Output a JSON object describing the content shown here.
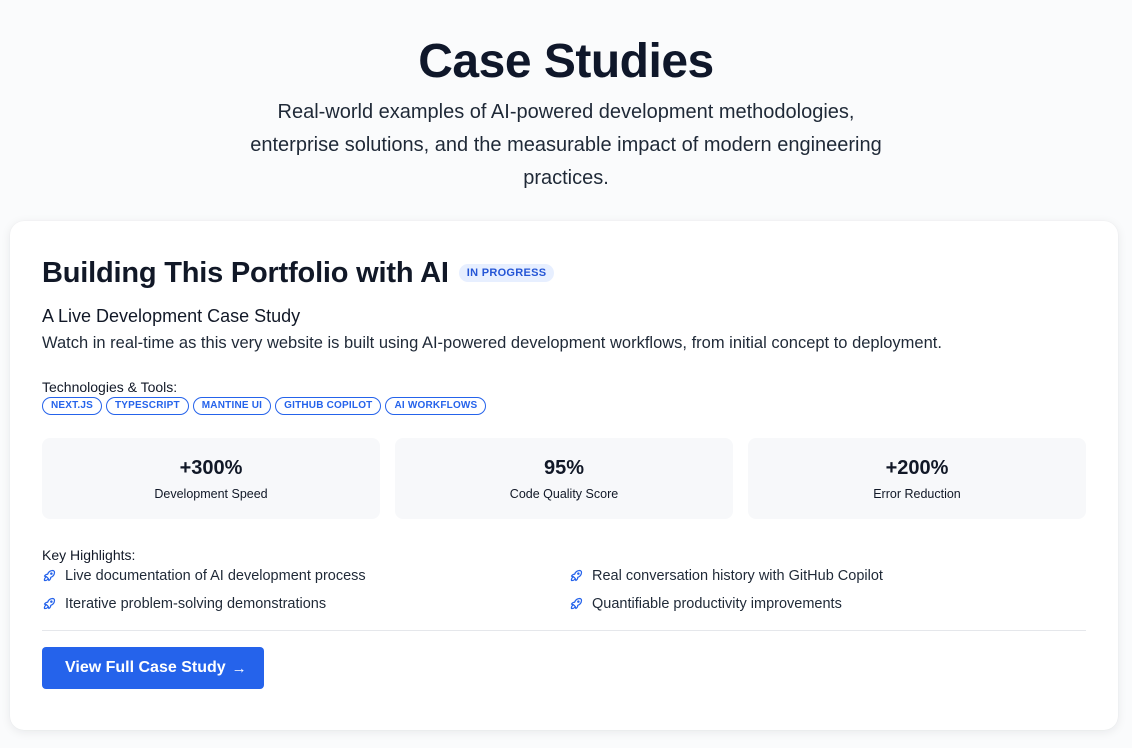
{
  "header": {
    "title": "Case Studies",
    "subtitle": "Real-world examples of AI-powered development methodologies, enterprise solutions, and the measurable impact of modern engineering practices."
  },
  "case_study": {
    "title": "Building This Portfolio with AI",
    "status": "IN PROGRESS",
    "subtitle": "A Live Development Case Study",
    "description": "Watch in real-time as this very website is built using AI-powered development workflows, from initial concept to deployment.",
    "technologies_label": "Technologies & Tools:",
    "technologies": [
      "NEXT.JS",
      "TYPESCRIPT",
      "MANTINE UI",
      "GITHUB COPILOT",
      "AI WORKFLOWS"
    ],
    "metrics": [
      {
        "value": "+300%",
        "label": "Development Speed"
      },
      {
        "value": "95%",
        "label": "Code Quality Score"
      },
      {
        "value": "+200%",
        "label": "Error Reduction"
      }
    ],
    "highlights_label": "Key Highlights:",
    "highlights": [
      "Live documentation of AI development process",
      "Real conversation history with GitHub Copilot",
      "Iterative problem-solving demonstrations",
      "Quantifiable productivity improvements"
    ],
    "cta_label": "View Full Case Study",
    "cta_arrow": "→"
  },
  "colors": {
    "accent": "#2563eb",
    "badge_bg": "#e7efff",
    "badge_text": "#2556d6",
    "metric_bg": "#f7f8fa"
  },
  "icons": {
    "highlight": "rocket-icon",
    "cta": "arrow-right-icon"
  }
}
